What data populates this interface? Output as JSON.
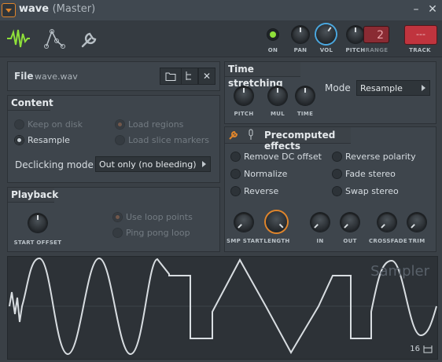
{
  "window": {
    "title": "wave",
    "subtitle": "(Master)",
    "minimize": "–",
    "close": "✕"
  },
  "toolbar": {
    "tabs": [
      {
        "name": "waveform-icon"
      },
      {
        "name": "envelope-icon"
      },
      {
        "name": "wrench-icon"
      }
    ],
    "on_label": "ON",
    "pan_label": "PAN",
    "vol_label": "VOL",
    "pitch_label": "PITCH",
    "range_label": "RANGE",
    "range_value": "2",
    "track_label": "TRACK",
    "track_value": "---"
  },
  "file": {
    "label": "File",
    "filename": "wave.wav"
  },
  "content": {
    "title": "Content",
    "keep_on_disk": "Keep on disk",
    "resample": "Resample",
    "load_regions": "Load regions",
    "load_slice_markers": "Load slice markers",
    "declicking_label": "Declicking mode",
    "declicking_value": "Out only (no bleeding)"
  },
  "playback": {
    "title": "Playback",
    "start_offset": "START OFFSET",
    "use_loop_points": "Use loop points",
    "ping_pong_loop": "Ping pong loop"
  },
  "time_stretching": {
    "title": "Time stretching",
    "pitch": "PITCH",
    "mul": "MUL",
    "time": "TIME",
    "mode_label": "Mode",
    "mode_value": "Resample"
  },
  "precomputed": {
    "title": "Precomputed effects",
    "remove_dc": "Remove DC offset",
    "normalize": "Normalize",
    "reverse": "Reverse",
    "reverse_polarity": "Reverse polarity",
    "fade_stereo": "Fade stereo",
    "swap_stereo": "Swap stereo",
    "knobs": {
      "smp_start": "SMP START",
      "length": "LENGTH",
      "in": "IN",
      "out": "OUT",
      "crossfade": "CROSSFADE",
      "trim": "TRIM"
    }
  },
  "waveform": {
    "watermark": "Sampler",
    "bits": "16"
  },
  "colors": {
    "accent": "#e0852b",
    "vol_ring": "#4aa8e0",
    "on_led": "#8fe03a",
    "track_red": "#c0343e",
    "wave": "#d8dde1"
  }
}
